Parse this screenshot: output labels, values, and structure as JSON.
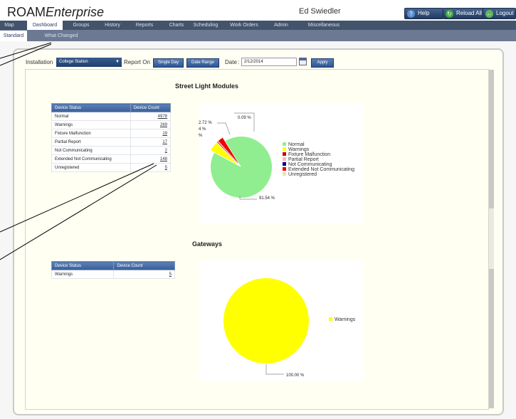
{
  "header": {
    "app_name_plain": "ROAM",
    "app_name_italic": "Enterprise",
    "user": "Ed Swiedler",
    "help": "Help",
    "reload": "Reload All",
    "logout": "Logout"
  },
  "menu": [
    "Map",
    "Dashboard",
    "Groups",
    "History",
    "Reports",
    "Charts",
    "Scheduling",
    "Work Orders",
    "Admin",
    "Miscellaneous"
  ],
  "submenu": [
    "Standard",
    "What Changed"
  ],
  "filters": {
    "installation_label": "Installation",
    "installation_value": "College Station",
    "report_on_label": "Report On",
    "single_day": "Single Day",
    "date_range": "Date Range",
    "date_label": "Date",
    "date_value": "2/12/2014",
    "apply": "Apply"
  },
  "street_lights": {
    "title": "Street Light Modules",
    "columns": [
      "Device Status",
      "Device Count"
    ],
    "rows": [
      {
        "status": "Normal",
        "count": "4978"
      },
      {
        "status": "Warnings",
        "count": "269"
      },
      {
        "status": "Fixture Malfunction",
        "count": "19"
      },
      {
        "status": "Partial Report",
        "count": "17"
      },
      {
        "status": "Not Communicating",
        "count": "2"
      },
      {
        "status": "Extended Not Communicating",
        "count": "148"
      },
      {
        "status": "Unregistered",
        "count": "5"
      }
    ],
    "callouts": [
      "0.09 %",
      "2.72 %",
      "4 %",
      "%",
      "91.54 %"
    ]
  },
  "gateways": {
    "title": "Gateways",
    "columns": [
      "Device Status",
      "Device Count"
    ],
    "rows": [
      {
        "status": "Warnings",
        "count": "5"
      }
    ],
    "callouts": [
      "100.00 %"
    ]
  },
  "chart_data": [
    {
      "type": "pie",
      "title": "",
      "categories": [
        "Normal",
        "Warnings",
        "Fixture Malfunction",
        "Partial Report",
        "Not Communicating",
        "Extended Not Communicating",
        "Unregistered"
      ],
      "values": [
        91.54,
        4.95,
        0.35,
        0.31,
        0.04,
        2.72,
        0.09
      ],
      "colors": [
        "#90ee90",
        "#ffff00",
        "#cc0000",
        "#ffb6c1",
        "#000080",
        "#ee0000",
        "#f5deb3"
      ],
      "legend": "right"
    },
    {
      "type": "pie",
      "title": "",
      "categories": [
        "Warnings"
      ],
      "values": [
        100.0
      ],
      "colors": [
        "#ffff00"
      ],
      "legend": "right"
    }
  ]
}
